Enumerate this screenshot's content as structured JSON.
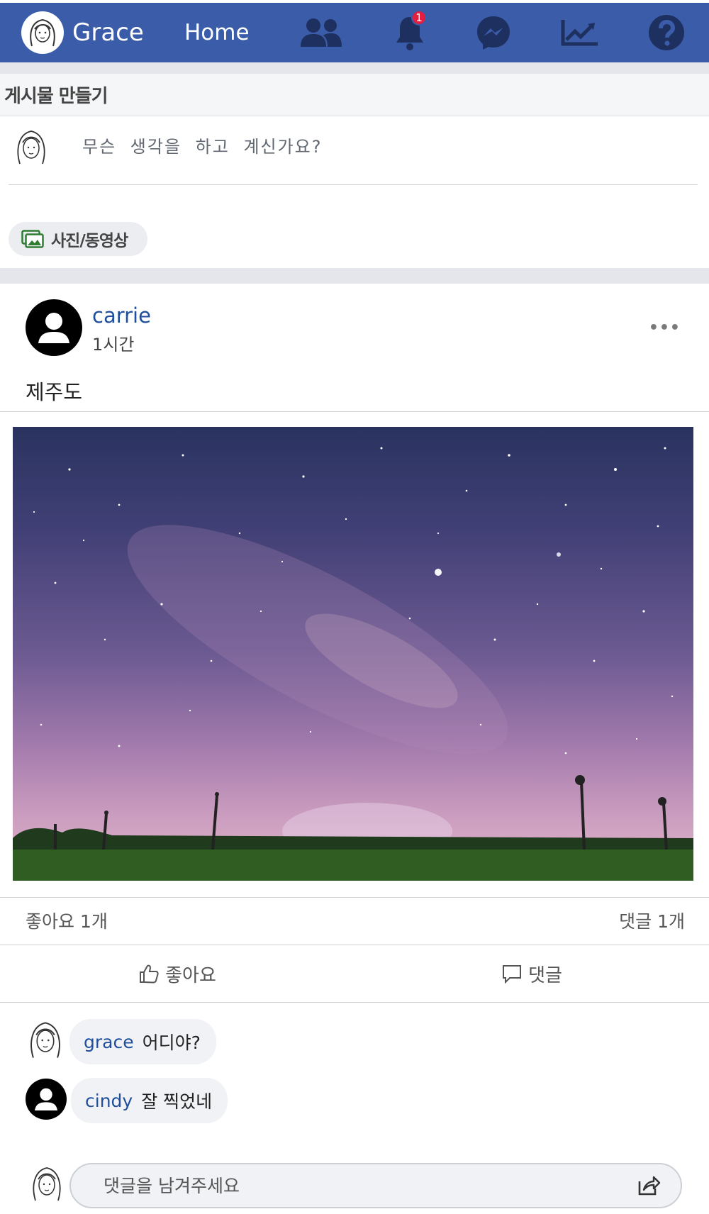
{
  "nav": {
    "user_name": "Grace",
    "home_label": "Home",
    "notification_count": "1",
    "icons": [
      "friends-icon",
      "bell-icon",
      "messenger-icon",
      "chart-icon",
      "help-icon"
    ],
    "color": "#3b5ca8"
  },
  "create_post": {
    "title": "게시물 만들기",
    "placeholder": "무슨 생각을 하고 계신가요?",
    "media_button": "사진/동영상"
  },
  "post": {
    "author": "carrie",
    "time": "1시간",
    "text": "제주도",
    "more": "•••",
    "likes": "좋아요 1개",
    "comments_count": "댓글 1개",
    "like_button": "좋아요",
    "comment_button": "댓글"
  },
  "comments": [
    {
      "name": "grace",
      "text": "어디야?"
    },
    {
      "name": "cindy",
      "text": "잘 찍었네"
    }
  ],
  "comment_input": {
    "placeholder": "댓글을 남겨주세요"
  }
}
